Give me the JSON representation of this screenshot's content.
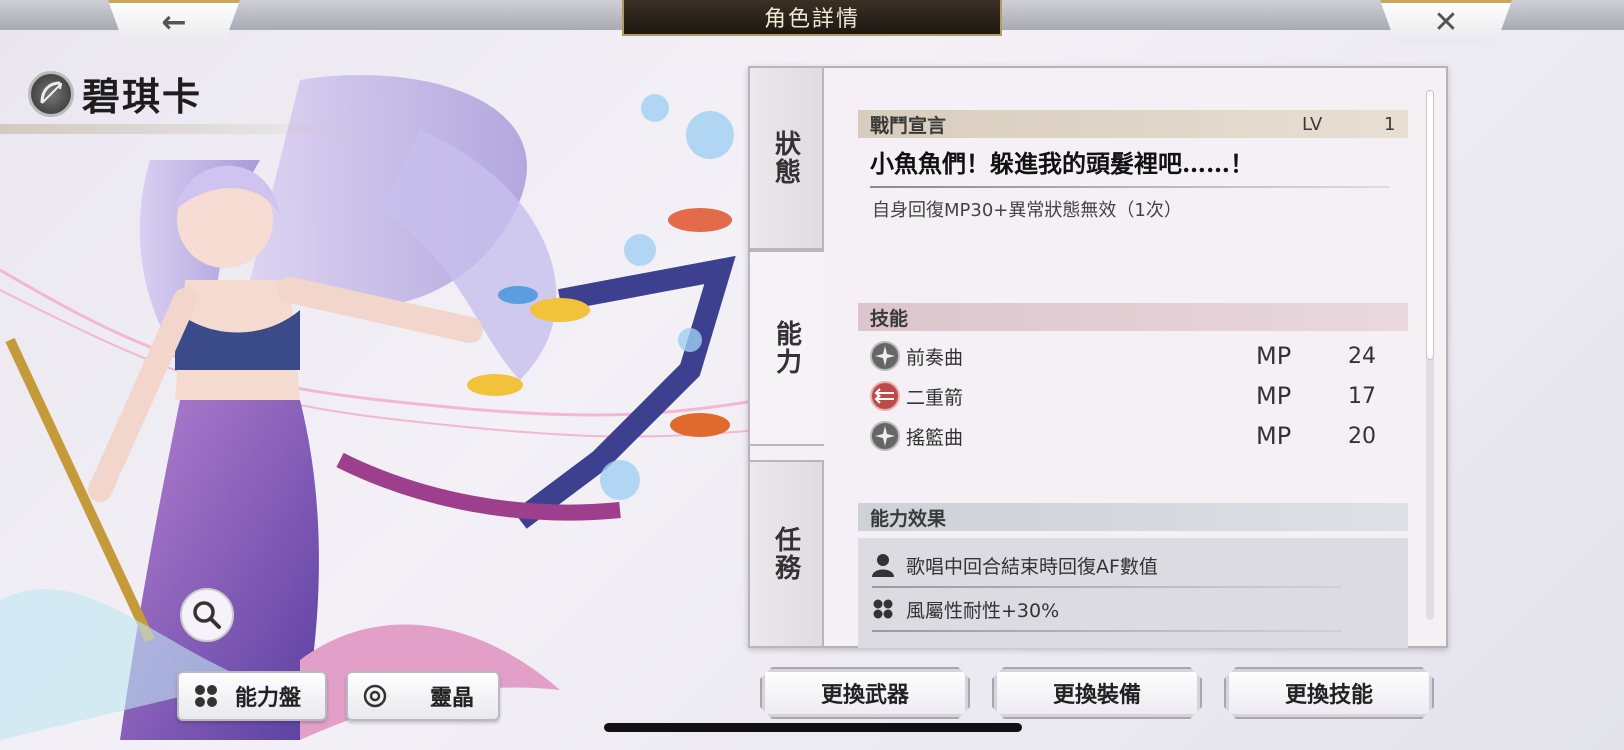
{
  "header": {
    "title": "角色詳情",
    "back_icon": "←",
    "close_icon": "✕"
  },
  "character": {
    "name": "碧琪卡",
    "class_icon": "bow-icon"
  },
  "tabs": [
    {
      "label": "狀態"
    },
    {
      "label": "能力"
    },
    {
      "label": "任務"
    }
  ],
  "battle_cry": {
    "header": "戰鬥宣言",
    "lv_label": "LV",
    "lv_value": "1",
    "quote": "小魚魚們！躲進我的頭髮裡吧……！",
    "description": "自身回復MP30+異常狀態無效（1次）"
  },
  "skills": {
    "header": "技能",
    "items": [
      {
        "name": "前奏曲",
        "mp_label": "MP",
        "mp": "24",
        "icon": "compass-star-icon"
      },
      {
        "name": "二重箭",
        "mp_label": "MP",
        "mp": "17",
        "icon": "double-arrow-icon"
      },
      {
        "name": "搖籃曲",
        "mp_label": "MP",
        "mp": "20",
        "icon": "compass-star-icon"
      }
    ]
  },
  "ability_effects": {
    "header": "能力效果",
    "items": [
      {
        "text": "歌唱中回合結束時回復AF數值",
        "icon": "person-icon"
      },
      {
        "text": "風屬性耐性+30%",
        "icon": "grid-dots-icon"
      }
    ]
  },
  "left_buttons": {
    "board": "能力盤",
    "spirit": "靈晶"
  },
  "actions": {
    "weapon": "更換武器",
    "equip": "更換裝備",
    "skill": "更換技能"
  },
  "colors": {
    "title_plate": "#2a221a",
    "gold_trim": "#b89a5c",
    "skill_header": "#dcc5cc"
  }
}
